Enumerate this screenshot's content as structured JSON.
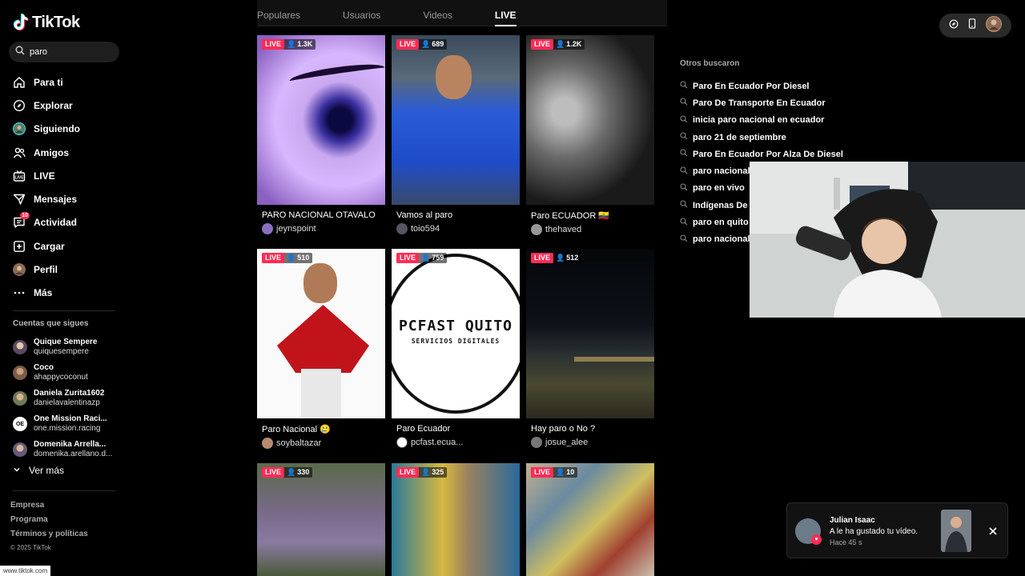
{
  "brand": {
    "name": "TikTok"
  },
  "search": {
    "value": "paro"
  },
  "nav": [
    {
      "label": "Para ti",
      "icon": "home-icon"
    },
    {
      "label": "Explorar",
      "icon": "compass-icon"
    },
    {
      "label": "Siguiendo",
      "icon": "following-avatar-icon"
    },
    {
      "label": "Amigos",
      "icon": "friends-icon"
    },
    {
      "label": "LIVE",
      "icon": "live-icon"
    },
    {
      "label": "Mensajes",
      "icon": "messages-icon"
    },
    {
      "label": "Actividad",
      "icon": "activity-icon",
      "badge": "10"
    },
    {
      "label": "Cargar",
      "icon": "upload-icon"
    },
    {
      "label": "Perfil",
      "icon": "profile-avatar-icon"
    },
    {
      "label": "Más",
      "icon": "more-icon"
    }
  ],
  "following": {
    "title": "Cuentas que sigues",
    "accounts": [
      {
        "name": "Quique Sempere",
        "user": "quiquesempere"
      },
      {
        "name": "Coco",
        "user": "ahappycoconut"
      },
      {
        "name": "Daniela Zurita1602",
        "user": "danielavalentinazp"
      },
      {
        "name": "One Mission Raci...",
        "user": "one.mission.racing"
      },
      {
        "name": "Domenika Arrella...",
        "user": "domenika.arellano.d..."
      }
    ],
    "more": "Ver más"
  },
  "footer": {
    "links": [
      "Empresa",
      "Programa",
      "Términos y políticas"
    ],
    "copyright": "© 2025 TikTok"
  },
  "status_url": "www.tiktok.com",
  "tabs": [
    {
      "label": "Populares",
      "active": false
    },
    {
      "label": "Usuarios",
      "active": false
    },
    {
      "label": "Videos",
      "active": false
    },
    {
      "label": "LIVE",
      "active": true
    }
  ],
  "live_badge": "LIVE",
  "cards": [
    {
      "viewers": "1.3K",
      "title": "PARO NACIONAL OTAVALO",
      "user": "jeynspoint"
    },
    {
      "viewers": "689",
      "title": "Vamos al paro",
      "user": "toio594"
    },
    {
      "viewers": "1.2K",
      "title": "Paro ECUADOR 🇪🇨",
      "user": "thehaved"
    },
    {
      "viewers": "510",
      "title": "Paro Nacional 🥲",
      "user": "soybaltazar"
    },
    {
      "viewers": "759",
      "title": "Paro Ecuador",
      "user": "pcfast.ecua..."
    },
    {
      "viewers": "512",
      "title": "Hay paro o No ?",
      "user": "josue_alee"
    },
    {
      "viewers": "330",
      "title": "",
      "user": ""
    },
    {
      "viewers": "325",
      "title": "",
      "user": ""
    },
    {
      "viewers": "10",
      "title": "",
      "user": ""
    }
  ],
  "pcfast_logo": {
    "line1": "PCFAST QUITO",
    "line2": "SERVICIOS DIGITALES"
  },
  "related": {
    "title": "Otros buscaron",
    "items": [
      "Paro En Ecuador Por Diesel",
      "Paro De Transporte En Ecuador",
      "inicia paro nacional en ecuador",
      "paro 21 de septiembre",
      "Paro En Ecuador Por Alza De Diesel",
      "paro nacional",
      "paro en vivo",
      "Indígenas De",
      "paro en quito",
      "paro nacional"
    ]
  },
  "toast": {
    "name": "Julian Isaac",
    "message": "A le ha gustado tu vídeo.",
    "time": "Hace 45 s"
  },
  "colors": {
    "accent": "#fe2c55",
    "background": "#000000"
  }
}
